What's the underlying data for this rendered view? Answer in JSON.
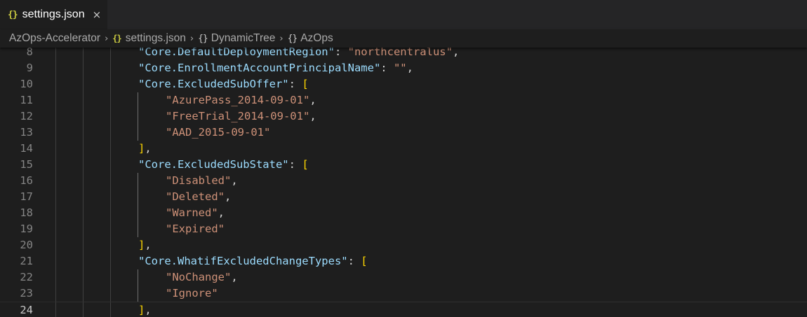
{
  "tab": {
    "icon": "json-file-icon",
    "label": "settings.json",
    "close": "×"
  },
  "breadcrumb": {
    "items": [
      {
        "label": "AzOps-Accelerator",
        "icon": ""
      },
      {
        "label": "settings.json",
        "icon": "json-file-icon",
        "glyph": "{}"
      },
      {
        "label": "DynamicTree",
        "icon": "object-icon",
        "glyph": "{}"
      },
      {
        "label": "AzOps",
        "icon": "object-icon",
        "glyph": "{}"
      }
    ],
    "separator": "›"
  },
  "editor": {
    "current_line": 24,
    "lines": [
      {
        "num": "8",
        "indent": 3,
        "tokens": [
          {
            "t": "key",
            "v": "\"Core.DefaultDeploymentRegion\""
          },
          {
            "t": "punc",
            "v": ": "
          },
          {
            "t": "str",
            "v": "\"northcentralus\""
          },
          {
            "t": "punc",
            "v": ","
          }
        ]
      },
      {
        "num": "9",
        "indent": 3,
        "tokens": [
          {
            "t": "key",
            "v": "\"Core.EnrollmentAccountPrincipalName\""
          },
          {
            "t": "punc",
            "v": ": "
          },
          {
            "t": "str",
            "v": "\"\""
          },
          {
            "t": "punc",
            "v": ","
          }
        ]
      },
      {
        "num": "10",
        "indent": 3,
        "tokens": [
          {
            "t": "key",
            "v": "\"Core.ExcludedSubOffer\""
          },
          {
            "t": "punc",
            "v": ": "
          },
          {
            "t": "brk",
            "v": "["
          }
        ]
      },
      {
        "num": "11",
        "indent": 4,
        "tokens": [
          {
            "t": "str",
            "v": "\"AzurePass_2014-09-01\""
          },
          {
            "t": "punc",
            "v": ","
          }
        ]
      },
      {
        "num": "12",
        "indent": 4,
        "tokens": [
          {
            "t": "str",
            "v": "\"FreeTrial_2014-09-01\""
          },
          {
            "t": "punc",
            "v": ","
          }
        ]
      },
      {
        "num": "13",
        "indent": 4,
        "tokens": [
          {
            "t": "str",
            "v": "\"AAD_2015-09-01\""
          }
        ]
      },
      {
        "num": "14",
        "indent": 3,
        "tokens": [
          {
            "t": "brk",
            "v": "]"
          },
          {
            "t": "punc",
            "v": ","
          }
        ]
      },
      {
        "num": "15",
        "indent": 3,
        "tokens": [
          {
            "t": "key",
            "v": "\"Core.ExcludedSubState\""
          },
          {
            "t": "punc",
            "v": ": "
          },
          {
            "t": "brk",
            "v": "["
          }
        ]
      },
      {
        "num": "16",
        "indent": 4,
        "tokens": [
          {
            "t": "str",
            "v": "\"Disabled\""
          },
          {
            "t": "punc",
            "v": ","
          }
        ]
      },
      {
        "num": "17",
        "indent": 4,
        "tokens": [
          {
            "t": "str",
            "v": "\"Deleted\""
          },
          {
            "t": "punc",
            "v": ","
          }
        ]
      },
      {
        "num": "18",
        "indent": 4,
        "tokens": [
          {
            "t": "str",
            "v": "\"Warned\""
          },
          {
            "t": "punc",
            "v": ","
          }
        ]
      },
      {
        "num": "19",
        "indent": 4,
        "tokens": [
          {
            "t": "str",
            "v": "\"Expired\""
          }
        ]
      },
      {
        "num": "20",
        "indent": 3,
        "tokens": [
          {
            "t": "brk",
            "v": "]"
          },
          {
            "t": "punc",
            "v": ","
          }
        ]
      },
      {
        "num": "21",
        "indent": 3,
        "tokens": [
          {
            "t": "key",
            "v": "\"Core.WhatifExcludedChangeTypes\""
          },
          {
            "t": "punc",
            "v": ": "
          },
          {
            "t": "brk",
            "v": "["
          }
        ]
      },
      {
        "num": "22",
        "indent": 4,
        "tokens": [
          {
            "t": "str",
            "v": "\"NoChange\""
          },
          {
            "t": "punc",
            "v": ","
          }
        ]
      },
      {
        "num": "23",
        "indent": 4,
        "tokens": [
          {
            "t": "str",
            "v": "\"Ignore\""
          }
        ]
      },
      {
        "num": "24",
        "indent": 3,
        "tokens": [
          {
            "t": "brk",
            "v": "]"
          },
          {
            "t": "punc",
            "v": ","
          }
        ]
      }
    ]
  },
  "colors": {
    "background": "#1e1e1e",
    "tab_bar": "#252526",
    "key": "#9cdcfe",
    "string": "#ce9178",
    "bracket": "#ffd700",
    "json_icon": "#cbcb41",
    "line_number": "#858585"
  }
}
